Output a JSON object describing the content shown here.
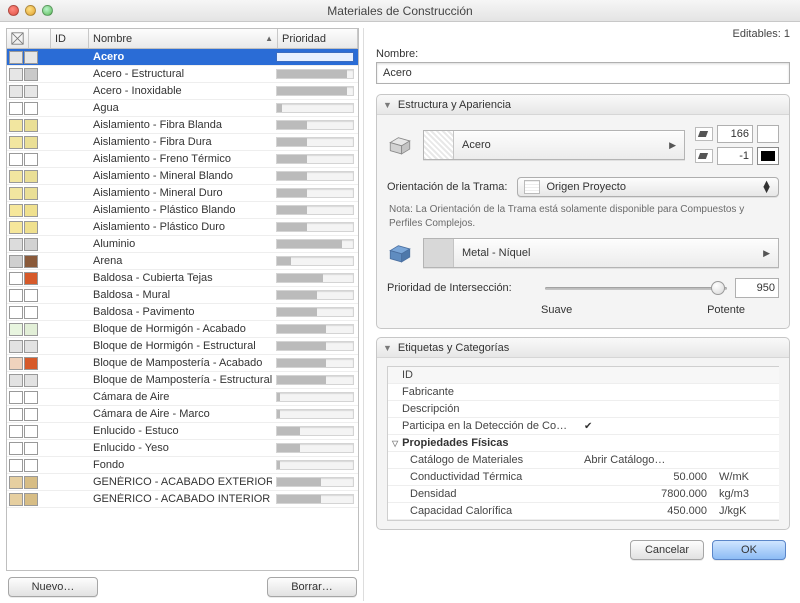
{
  "window_title": "Materiales de Construcción",
  "editable": "Editables: 1",
  "headers": {
    "id": "ID",
    "name": "Nombre",
    "priority": "Prioridad"
  },
  "buttons": {
    "new": "Nuevo…",
    "delete": "Borrar…",
    "cancel": "Cancelar",
    "ok": "OK"
  },
  "materials": [
    {
      "name": "Acero",
      "c1": "#e6e6e6",
      "c2": "#e6e6e6",
      "pr": 100,
      "sel": true
    },
    {
      "name": "Acero - Estructural",
      "c1": "#e6e6e6",
      "c2": "#c9c9c9",
      "pr": 92
    },
    {
      "name": "Acero - Inoxidable",
      "c1": "#e6e6e6",
      "c2": "#e6e6e6",
      "pr": 92
    },
    {
      "name": "Agua",
      "c1": "#ffffff",
      "c2": "#ffffff",
      "pr": 6
    },
    {
      "name": "Aislamiento - Fibra Blanda",
      "c1": "#f2e6a0",
      "c2": "#eadf96",
      "pr": 40
    },
    {
      "name": "Aislamiento - Fibra Dura",
      "c1": "#f2e6a0",
      "c2": "#eadf96",
      "pr": 40
    },
    {
      "name": "Aislamiento - Freno Térmico",
      "c1": "#ffffff",
      "c2": "#ffffff",
      "pr": 40
    },
    {
      "name": "Aislamiento - Mineral Blando",
      "c1": "#f2e6a0",
      "c2": "#eadf96",
      "pr": 40
    },
    {
      "name": "Aislamiento - Mineral Duro",
      "c1": "#f2e6a0",
      "c2": "#eadf96",
      "pr": 40
    },
    {
      "name": "Aislamiento - Plástico Blando",
      "c1": "#f6e79b",
      "c2": "#efe08e",
      "pr": 40
    },
    {
      "name": "Aislamiento - Plástico Duro",
      "c1": "#f6e79b",
      "c2": "#efe08e",
      "pr": 40
    },
    {
      "name": "Aluminio",
      "c1": "#dcdcdc",
      "c2": "#d2d2d2",
      "pr": 86
    },
    {
      "name": "Arena",
      "c1": "#cfcfcf",
      "c2": "#8a5a3a",
      "pr": 18
    },
    {
      "name": "Baldosa - Cubierta Tejas",
      "c1": "#ffffff",
      "c2": "#d65a2a",
      "pr": 60
    },
    {
      "name": "Baldosa - Mural",
      "c1": "#ffffff",
      "c2": "#ffffff",
      "pr": 52
    },
    {
      "name": "Baldosa - Pavimento",
      "c1": "#ffffff",
      "c2": "#ffffff",
      "pr": 52
    },
    {
      "name": "Bloque de Hormigón - Acabado",
      "c1": "#e8f5df",
      "c2": "#e2efd7",
      "pr": 64
    },
    {
      "name": "Bloque de Hormigón - Estructural",
      "c1": "#e2e2e2",
      "c2": "#e2e2e2",
      "pr": 64
    },
    {
      "name": "Bloque de Mampostería - Acabado",
      "c1": "#f0d3bd",
      "c2": "#d65a2a",
      "pr": 64
    },
    {
      "name": "Bloque de Mampostería - Estructural",
      "c1": "#e2e2e2",
      "c2": "#e2e2e2",
      "pr": 64
    },
    {
      "name": "Cámara de Aire",
      "c1": "#ffffff",
      "c2": "#ffffff",
      "pr": 4
    },
    {
      "name": "Cámara de Aire - Marco",
      "c1": "#ffffff",
      "c2": "#ffffff",
      "pr": 4
    },
    {
      "name": "Enlucido - Estuco",
      "c1": "#ffffff",
      "c2": "#ffffff",
      "pr": 30
    },
    {
      "name": "Enlucido - Yeso",
      "c1": "#ffffff",
      "c2": "#ffffff",
      "pr": 30
    },
    {
      "name": "Fondo",
      "c1": "#ffffff",
      "c2": "#ffffff",
      "pr": 4
    },
    {
      "name": "GENÉRICO - ACABADO EXTERIOR",
      "c1": "#e6cfa0",
      "c2": "#d7bd85",
      "pr": 58
    },
    {
      "name": "GENÉRICO - ACABADO INTERIOR",
      "c1": "#e6cfa0",
      "c2": "#d7bd85",
      "pr": 58
    }
  ],
  "right": {
    "name_label": "Nombre:",
    "name_value": "Acero",
    "sections": {
      "structure": "Estructura y Apariencia",
      "tags": "Etiquetas y Categorías"
    },
    "fill1": "Acero",
    "fill2": "Metal - Níquel",
    "val_top": "166",
    "val_bot": "-1",
    "orient_label": "Orientación de la Trama:",
    "orient_value": "Origen Proyecto",
    "note": "Nota: La Orientación de la Trama está solamente disponible para Compuestos y Perfiles Complejos.",
    "intersec_label": "Prioridad de Intersección:",
    "intersec_value": "950",
    "slider_left": "Suave",
    "slider_right": "Potente",
    "props": {
      "id": "ID",
      "fabricante": "Fabricante",
      "descripcion": "Descripción",
      "participa": "Participa en la Detección de Co…",
      "group": "Propiedades Físicas",
      "catalog_k": "Catálogo de Materiales",
      "catalog_v": "Abrir Catálogo…",
      "cond_k": "Conductividad Térmica",
      "cond_v": "50.000",
      "cond_u": "W/mK",
      "dens_k": "Densidad",
      "dens_v": "7800.000",
      "dens_u": "kg/m3",
      "cap_k": "Capacidad Calorífica",
      "cap_v": "450.000",
      "cap_u": "J/kgK"
    }
  }
}
